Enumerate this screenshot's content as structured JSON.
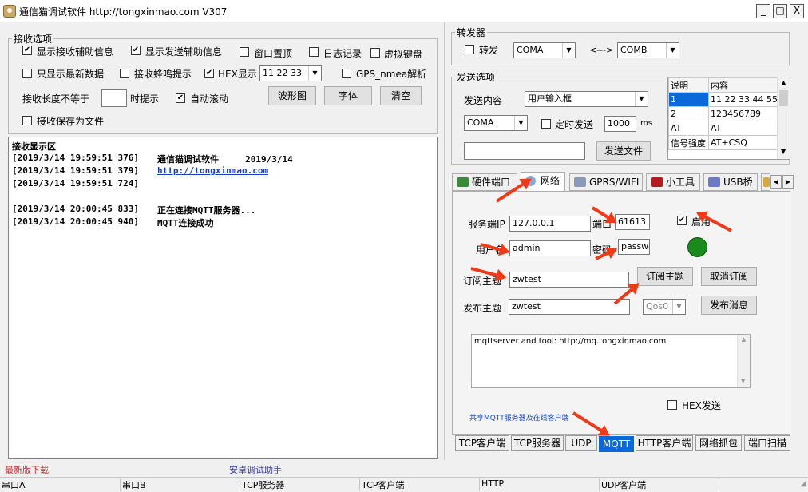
{
  "window": {
    "title": "通信猫调试软件  http://tongxinmao.com  V307",
    "buttons": {
      "minimize": "_",
      "maximize": "□",
      "close": "X"
    }
  },
  "receive_options": {
    "legend": "接收选项",
    "show_recv_info": "显示接收辅助信息",
    "show_send_info": "显示发送辅助信息",
    "window_top": "窗口置顶",
    "log": "日志记录",
    "virtual_keyboard": "虚拟键盘",
    "latest_only": "只显示最新数据",
    "beep": "接收蜂鸣提示",
    "hex_display": "HEX显示",
    "hex_sample": "11 22 33",
    "gps": "GPS_nmea解析",
    "len_prompt_prefix": "接收长度不等于",
    "len_prompt_suffix": "时提示",
    "auto_scroll": "自动滚动",
    "waveform_button": "波形图",
    "font_button": "字体",
    "clear_button": "清空",
    "save_to_file": "接收保存为文件"
  },
  "receive_area": {
    "title": "接收显示区",
    "lines": [
      {
        "time": "[2019/3/14 19:59:51 376]",
        "text": "通信猫调试软件     2019/3/14"
      },
      {
        "time": "[2019/3/14 19:59:51 379]",
        "link": "http://tongxinmao.com"
      },
      {
        "time": "[2019/3/14 19:59:51 724]",
        "text": ""
      },
      {
        "time": "[2019/3/14 20:00:45 833]",
        "text": "正在连接MQTT服务器..."
      },
      {
        "time": "[2019/3/14 20:00:45 940]",
        "text": "MQTT连接成功"
      }
    ]
  },
  "forwarder": {
    "legend": "转发器",
    "forward_label": "转发",
    "from_port": "COMA",
    "arrow": "<--->",
    "to_port": "COMB"
  },
  "send_options": {
    "legend": "发送选项",
    "content_label": "发送内容",
    "content_mode": "用户输入框",
    "port": "COMA",
    "timed_send": "定时发送",
    "interval": "1000",
    "interval_unit": "ms",
    "send_file_button": "发送文件",
    "table_headers": [
      "说明",
      "内容"
    ],
    "table_rows": [
      [
        "1",
        "11 22 33 44 55"
      ],
      [
        "2",
        "123456789"
      ],
      [
        "AT",
        "AT"
      ],
      [
        "信号强度",
        "AT+CSQ"
      ]
    ]
  },
  "top_tabs": [
    "硬件端口",
    "网络",
    "GPRS/WIFI",
    "小工具",
    "USB桥"
  ],
  "mqtt": {
    "server_ip_label": "服务端IP",
    "server_ip": "127.0.0.1",
    "port_label": "端口",
    "port": "61613",
    "enable_label": "启用",
    "username_label": "用户名",
    "username": "admin",
    "password_label": "密码",
    "password": "passwo",
    "subscribe_topic_label": "订阅主题",
    "subscribe_topic": "zwtest",
    "subscribe_button": "订阅主题",
    "unsubscribe_button": "取消订阅",
    "publish_topic_label": "发布主题",
    "publish_topic": "zwtest",
    "qos": "Qos0",
    "publish_button": "发布消息",
    "message": "mqttserver and tool: http://mq.tongxinmao.com",
    "hex_send": "HEX发送",
    "footer_link": "共享MQTT服务器及在线客户端",
    "status_color": "#1a8a1a"
  },
  "bottom_tabs": [
    "TCP客户端",
    "TCP服务器",
    "UDP",
    "MQTT",
    "HTTP客户端",
    "网络抓包",
    "端口扫描"
  ],
  "footer_links": {
    "download": "最新版下载",
    "android": "安卓调试助手"
  },
  "status_bar": [
    "串口A",
    "串口B",
    "TCP服务器",
    "TCP客户端",
    "HTTP",
    "UDP客户端"
  ]
}
